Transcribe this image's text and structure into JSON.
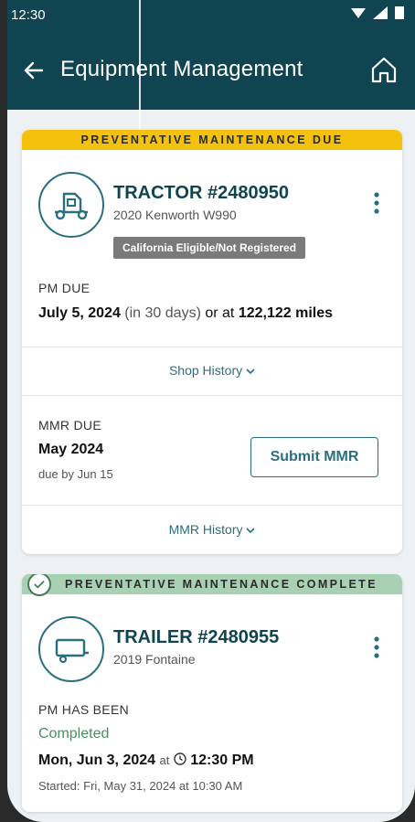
{
  "status": {
    "time": "12:30"
  },
  "header": {
    "title": "Equipment Management"
  },
  "card1": {
    "banner": "PREVENTATIVE MAINTENANCE DUE",
    "unit": "TRACTOR #2480950",
    "model": "2020 Kenworth W990",
    "tag": "California Eligible/Not Registered",
    "pm_label": "PM DUE",
    "pm_date": "July 5, 2024",
    "pm_days": "(in 30 days)",
    "pm_or": "or at",
    "pm_miles": "122,122 miles",
    "shop_history": "Shop History",
    "mmr_label": "MMR DUE",
    "mmr_month": "May 2024",
    "mmr_due": "due by Jun 15",
    "submit": "Submit MMR",
    "mmr_history": "MMR History"
  },
  "card2": {
    "banner": "PREVENTATIVE MAINTENANCE COMPLETE",
    "unit": "TRAILER #2480955",
    "model": "2019 Fontaine",
    "pm_label": "PM HAS BEEN",
    "status": "Completed",
    "done_date": "Mon, Jun 3, 2024",
    "at": "at",
    "done_time": "12:30 PM",
    "started": "Started: Fri, May 31, 2024 at 10:30 AM"
  },
  "colors": {
    "header": "#0f4450",
    "accent": "#2a6f80",
    "due": "#f4c20d",
    "complete": "#a8d0b3"
  },
  "icons": [
    "back-arrow-icon",
    "home-icon",
    "tractor-icon",
    "trailer-icon",
    "kebab-icon",
    "chevron-down-icon",
    "check-circle-icon",
    "clock-icon"
  ]
}
